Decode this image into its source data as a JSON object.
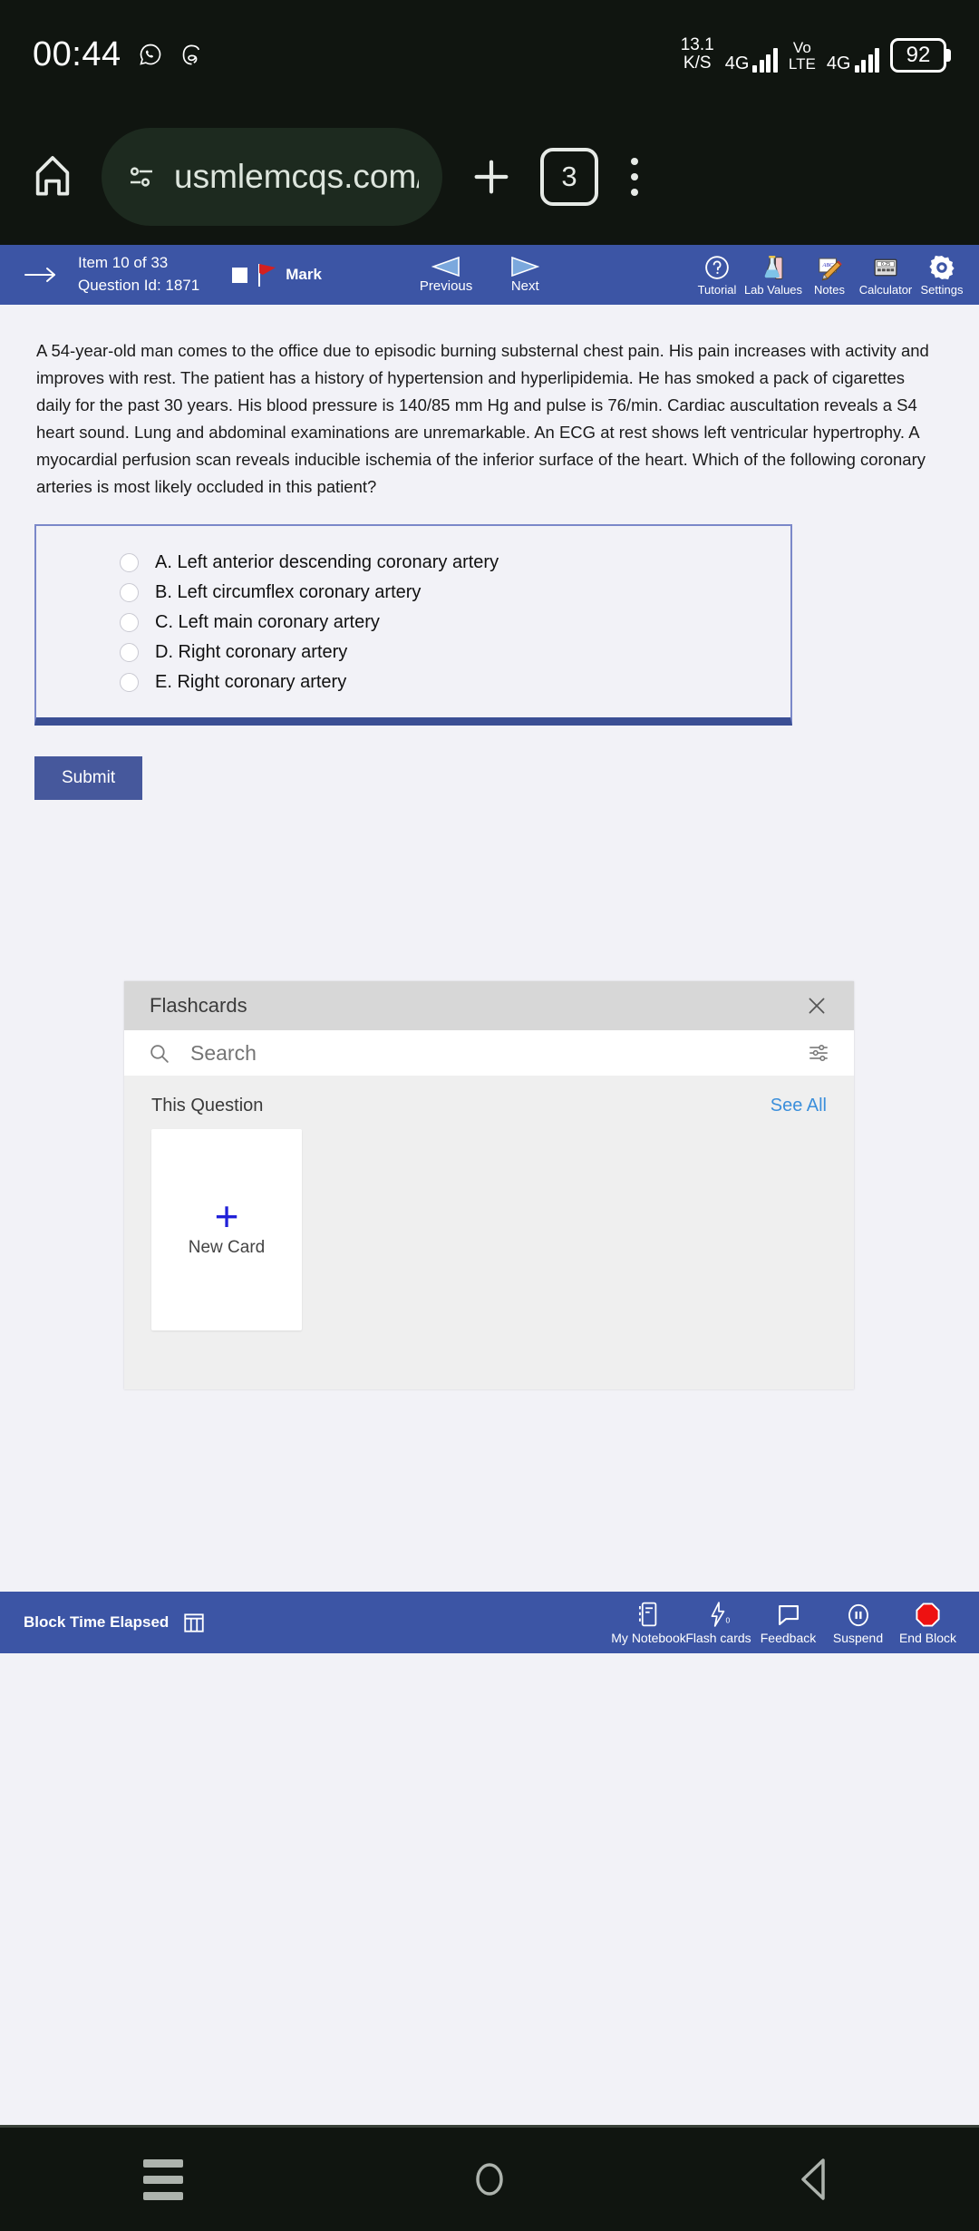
{
  "statusbar": {
    "time": "00:44",
    "app_icons": [
      "whatsapp-icon",
      "threads-icon"
    ],
    "net_speed_value": "13.1",
    "net_speed_unit": "K/S",
    "sim1_network": "4G",
    "volte_line1": "Vo",
    "volte_line2": "LTE",
    "sim2_network": "4G",
    "battery_percent": "92"
  },
  "browser": {
    "home_icon": "home-icon",
    "url_icon": "page-info-icon",
    "url": "usmlemcqs.com/us",
    "new_tab_icon": "plus-icon",
    "tab_count": "3",
    "menu_icon": "overflow-menu-icon"
  },
  "header": {
    "back_arrow": "arrow-right-icon",
    "item_counter": "Item 10 of 33",
    "question_id": "Question Id: 1871",
    "mark_label": "Mark",
    "previous_label": "Previous",
    "next_label": "Next",
    "tools": [
      {
        "label": "Tutorial",
        "icon": "question-mark-circle-icon"
      },
      {
        "label": "Lab Values",
        "icon": "flask-icon"
      },
      {
        "label": "Notes",
        "icon": "note-pencil-icon"
      },
      {
        "label": "Calculator",
        "icon": "calculator-icon",
        "display": "0.25"
      },
      {
        "label": "Settings",
        "icon": "gear-icon"
      }
    ]
  },
  "question": {
    "stem": "A 54-year-old man comes to the office due to episodic burning substernal chest pain.  His pain increases with activity and improves with rest.  The patient has a history of hypertension and hyperlipidemia.  He has smoked a pack of cigarettes daily for the past 30 years.  His blood pressure is 140/85 mm Hg and pulse is 76/min.  Cardiac auscultation reveals a S4 heart sound.  Lung and abdominal examinations are unremarkable.  An ECG at rest shows left ventricular hypertrophy.  A myocardial perfusion scan reveals inducible ischemia of the inferior surface of the heart.  Which of the following coronary arteries is most likely occluded in this patient?",
    "options": [
      {
        "letter": "A.",
        "text": "Left anterior descending coronary artery"
      },
      {
        "letter": "B.",
        "text": "Left circumflex coronary artery"
      },
      {
        "letter": "C.",
        "text": "Left main coronary artery"
      },
      {
        "letter": "D.",
        "text": "Right coronary artery"
      },
      {
        "letter": "E.",
        "text": "Right coronary artery"
      }
    ],
    "submit_label": "Submit",
    "selected_option": null
  },
  "flashcards_panel": {
    "title": "Flashcards",
    "close_icon": "close-icon",
    "search_icon": "search-icon",
    "search_placeholder": "Search",
    "search_value": "",
    "filter_icon": "tune-filter-icon",
    "section_label": "This Question",
    "see_all_label": "See All",
    "new_card_plus": "+",
    "new_card_label": "New Card"
  },
  "footer": {
    "block_time_label": "Block Time Elapsed",
    "block_time_icon": "calendar-icon",
    "tools": [
      {
        "label": "My Notebook",
        "icon": "notebook-icon"
      },
      {
        "label": "Flash cards",
        "icon": "lightning-bolt-icon",
        "badge": "0"
      },
      {
        "label": "Feedback",
        "icon": "speech-bubble-icon"
      },
      {
        "label": "Suspend",
        "icon": "pause-circle-icon"
      },
      {
        "label": "End Block",
        "icon": "stop-octagon-icon"
      }
    ]
  },
  "androidnav": {
    "recents_icon": "recents-icon",
    "home_icon": "home-circle-icon",
    "back_icon": "back-triangle-icon"
  },
  "colors": {
    "header_blue": "#3c55a5",
    "accent_blue": "#46589c",
    "answer_border": "#7b88c9",
    "answer_underline": "#3b4f94",
    "link_blue": "#3b8fdb",
    "page_bg": "#f2f2f7",
    "panel_bg": "#efefef",
    "panel_header": "#d7d7d7",
    "end_block_red": "#ee1111",
    "plus_blue": "#2121d8",
    "system_bg": "#101510"
  }
}
